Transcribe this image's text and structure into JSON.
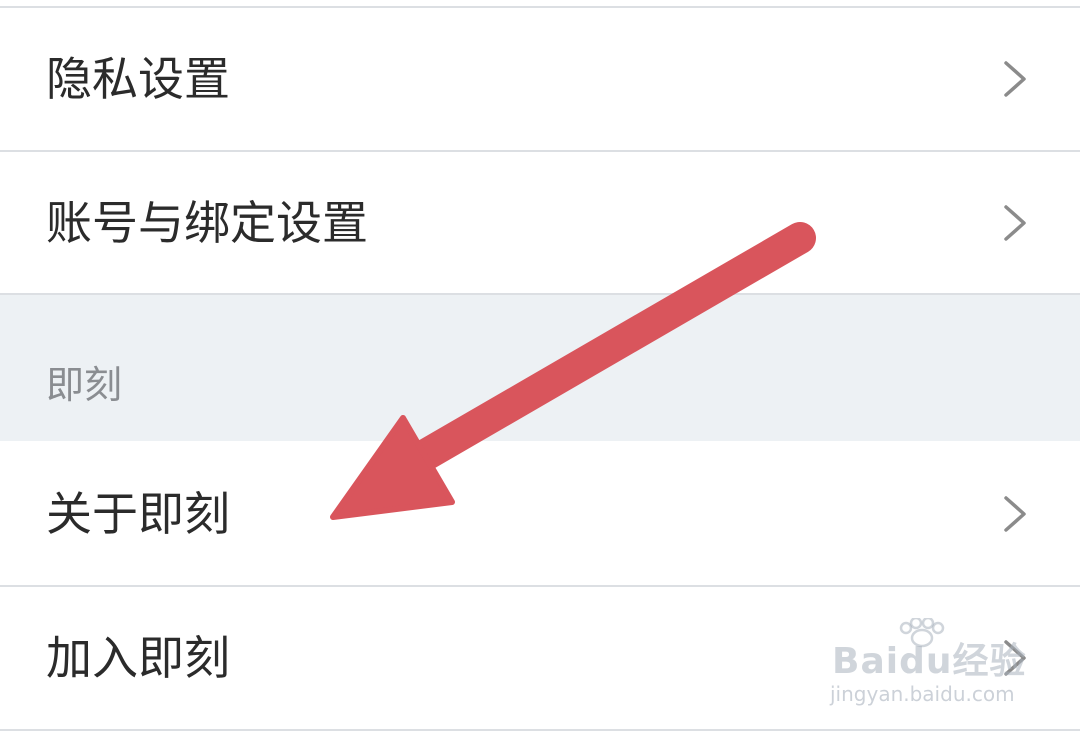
{
  "settings_list": {
    "items_top": [
      {
        "label": "隐私设置"
      },
      {
        "label": "账号与绑定设置"
      }
    ],
    "section": {
      "title": "即刻"
    },
    "items_bottom": [
      {
        "label": "关于即刻"
      },
      {
        "label": "加入即刻"
      }
    ]
  },
  "annotation": {
    "color": "#d9555c",
    "icon": "arrow-pointer"
  },
  "watermark": {
    "logo": "Baidu经验",
    "url": "jingyan.baidu.com"
  },
  "colors": {
    "section_bg": "#edf1f4",
    "divider": "#dcdfe3",
    "text": "#2b2b2b",
    "chevron": "#8b8b8b"
  }
}
